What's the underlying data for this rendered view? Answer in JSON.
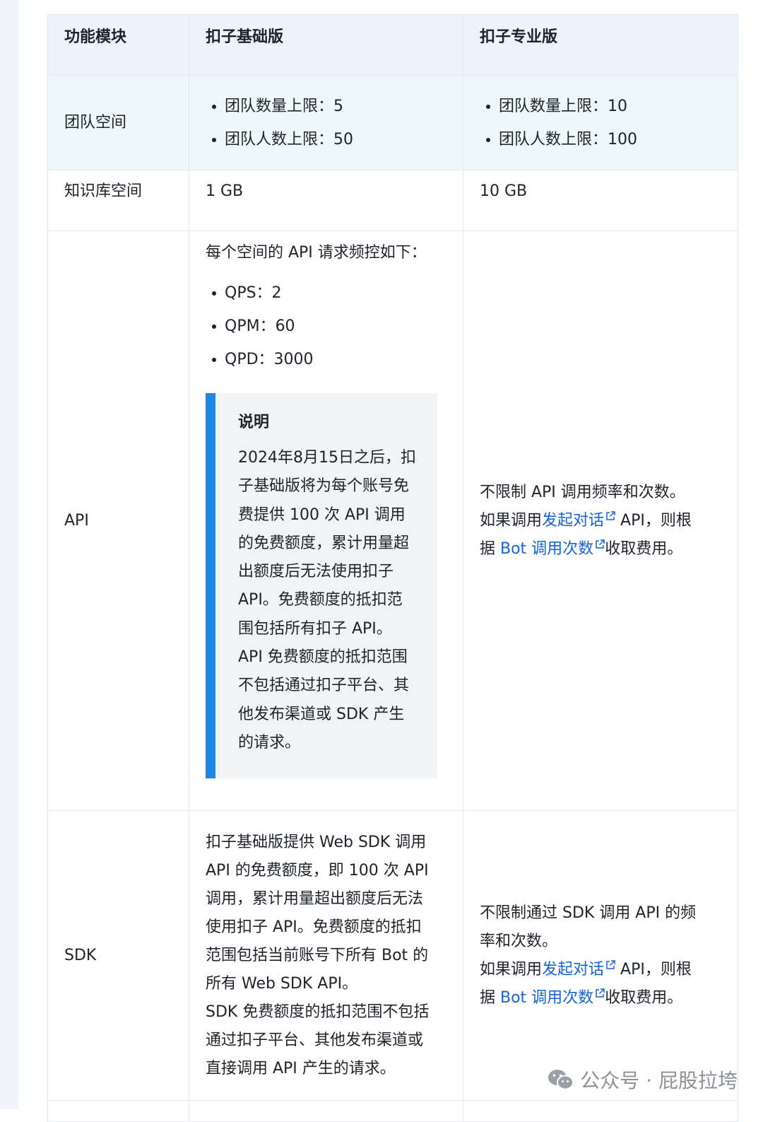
{
  "table": {
    "headers": [
      "功能模块",
      "扣子基础版",
      "扣子专业版"
    ],
    "team": {
      "label": "团队空间",
      "basic": [
        "团队数量上限：5",
        "团队人数上限：50"
      ],
      "pro": [
        "团队数量上限：10",
        "团队人数上限：100"
      ]
    },
    "kb": {
      "label": "知识库空间",
      "basic": "1 GB",
      "pro": "10 GB"
    },
    "api": {
      "label": "API",
      "basic_intro": "每个空间的 API 请求频控如下：",
      "basic_items": [
        "QPS：2",
        "QPM：60",
        "QPD：3000"
      ],
      "note_title": "说明",
      "note_lines": [
        "2024年8月15日之后，扣",
        "子基础版将为每个账号免",
        "费提供 100 次 API 调用",
        "的免费额度，累计用量超",
        "出额度后无法使用扣子",
        "API。免费额度的抵扣范",
        "围包括所有扣子 API。",
        "API 免费额度的抵扣范围",
        "不包括通过扣子平台、其",
        "他发布渠道或 SDK 产生",
        "的请求。"
      ],
      "pro_line1": "不限制 API 调用频率和次数。",
      "pro_prefix": "如果调用",
      "pro_link1": "发起对话",
      "pro_mid": " API，则根",
      "pro_prefix2": "据 ",
      "pro_link2": "Bot 调用次数",
      "pro_suffix": "收取费用。"
    },
    "sdk": {
      "label": "SDK",
      "basic_lines": [
        "扣子基础版提供 Web SDK 调用",
        "API 的免费额度，即 100 次 API",
        "调用，累计用量超出额度后无法",
        "使用扣子 API。免费额度的抵扣",
        "范围包括当前账号下所有 Bot 的",
        "所有 Web SDK API。",
        "SDK 免费额度的抵扣范围不包括",
        "通过扣子平台、其他发布渠道或",
        "直接调用 API 产生的请求。"
      ],
      "pro_line1": "不限制通过 SDK 调用 API 的频",
      "pro_line2": "率和次数。",
      "pro_prefix": "如果调用",
      "pro_link1": "发起对话",
      "pro_mid": " API，则根",
      "pro_prefix2": "据 ",
      "pro_link2": "Bot 调用次数",
      "pro_suffix": "收取费用。"
    }
  },
  "watermark": {
    "text": "公众号 · 屁股拉垮",
    "icon": "wechat-icon"
  },
  "colors": {
    "header_bg": "#edf3fb",
    "team_row_bg": "#eef8fc",
    "link": "#1664d8",
    "note_bar": "#1e88e5",
    "note_bg": "#f2f3f5"
  }
}
